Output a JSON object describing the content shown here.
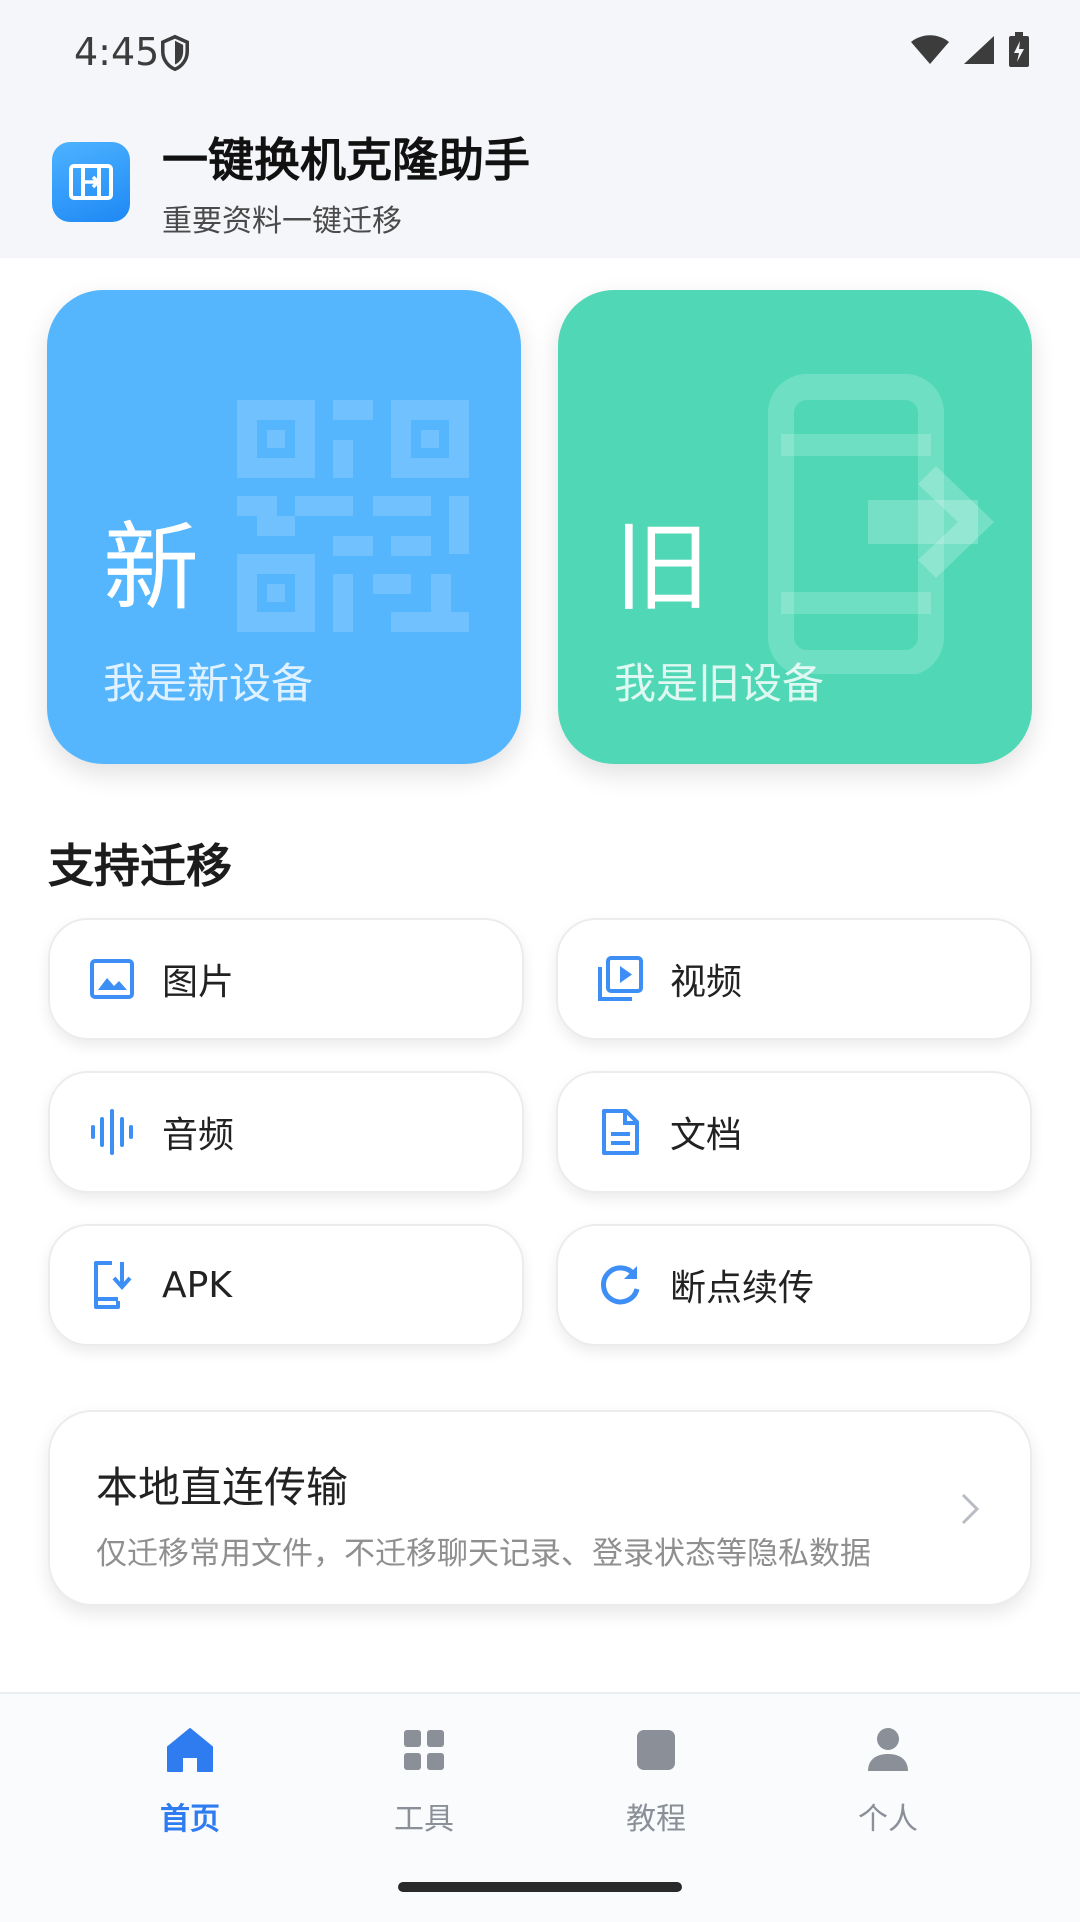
{
  "status_bar": {
    "time": "4:45"
  },
  "header": {
    "title": "一键换机克隆助手",
    "subtitle": "重要资料一键迁移"
  },
  "roles": [
    {
      "char": "新",
      "label": "我是新设备",
      "color": "#55b6fe"
    },
    {
      "char": "旧",
      "label": "我是旧设备",
      "color": "#50d8b6"
    }
  ],
  "section_title": "支持迁移",
  "types": [
    {
      "label": "图片",
      "icon": "image-icon"
    },
    {
      "label": "视频",
      "icon": "video-icon"
    },
    {
      "label": "音频",
      "icon": "audio-wave-icon"
    },
    {
      "label": "文档",
      "icon": "document-icon"
    },
    {
      "label": "APK",
      "icon": "apk-download-icon"
    },
    {
      "label": "断点续传",
      "icon": "resume-refresh-icon"
    }
  ],
  "transfer": {
    "title": "本地直连传输",
    "desc": "仅迁移常用文件，不迁移聊天记录、登录状态等隐私数据"
  },
  "nav": [
    {
      "label": "首页",
      "icon": "home-icon",
      "active": true
    },
    {
      "label": "工具",
      "icon": "grid-icon",
      "active": false
    },
    {
      "label": "教程",
      "icon": "book-icon",
      "active": false
    },
    {
      "label": "个人",
      "icon": "person-icon",
      "active": false
    }
  ],
  "colors": {
    "accent": "#2f7cf0",
    "icon_blue": "#3d8ef5",
    "nav_inactive": "#8a8f98"
  }
}
